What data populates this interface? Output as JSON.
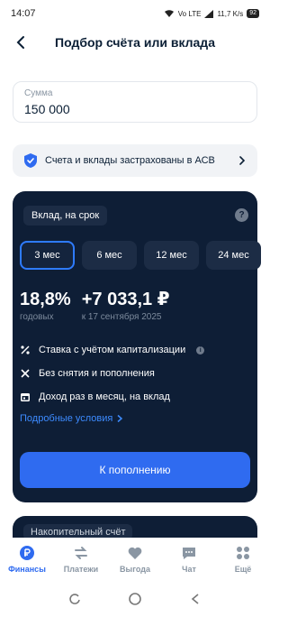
{
  "status_bar": {
    "time": "14:07",
    "network": "Vo LTE",
    "speed": "11,7 K/s",
    "battery": "92"
  },
  "header": {
    "title": "Подбор счёта или вклада"
  },
  "amount": {
    "label": "Сумма",
    "value": "150 000"
  },
  "insurance": {
    "text": "Счета и вклады застрахованы в АСВ"
  },
  "deposit_card": {
    "title": "Вклад, на срок",
    "terms": [
      {
        "label": "3 мес",
        "selected": true
      },
      {
        "label": "6 мес",
        "selected": false
      },
      {
        "label": "12 мес",
        "selected": false
      },
      {
        "label": "24 мес",
        "selected": false
      }
    ],
    "rate": "18,8%",
    "rate_caption": "годовых",
    "income": "+7 033,1 ₽",
    "income_caption": "к 17 сентября 2025",
    "features": [
      "Ставка с учётом капитализации",
      "Без снятия и пополнения",
      "Доход раз в месяц, на вклад"
    ],
    "details_link": "Подробные условия",
    "cta": "К пополнению"
  },
  "next_card": {
    "title": "Накопительный счёт"
  },
  "tabbar": {
    "items": [
      {
        "label": "Финансы",
        "icon": "ruble-icon",
        "active": true
      },
      {
        "label": "Платежи",
        "icon": "transfer-arrows-icon",
        "active": false
      },
      {
        "label": "Выгода",
        "icon": "heart-icon",
        "active": false
      },
      {
        "label": "Чат",
        "icon": "chat-icon",
        "active": false
      },
      {
        "label": "Ещё",
        "icon": "grid-icon",
        "active": false
      }
    ]
  },
  "colors": {
    "accent": "#2f6bf0",
    "card_dark": "#0e1e36",
    "chip": "#1c2c45"
  }
}
